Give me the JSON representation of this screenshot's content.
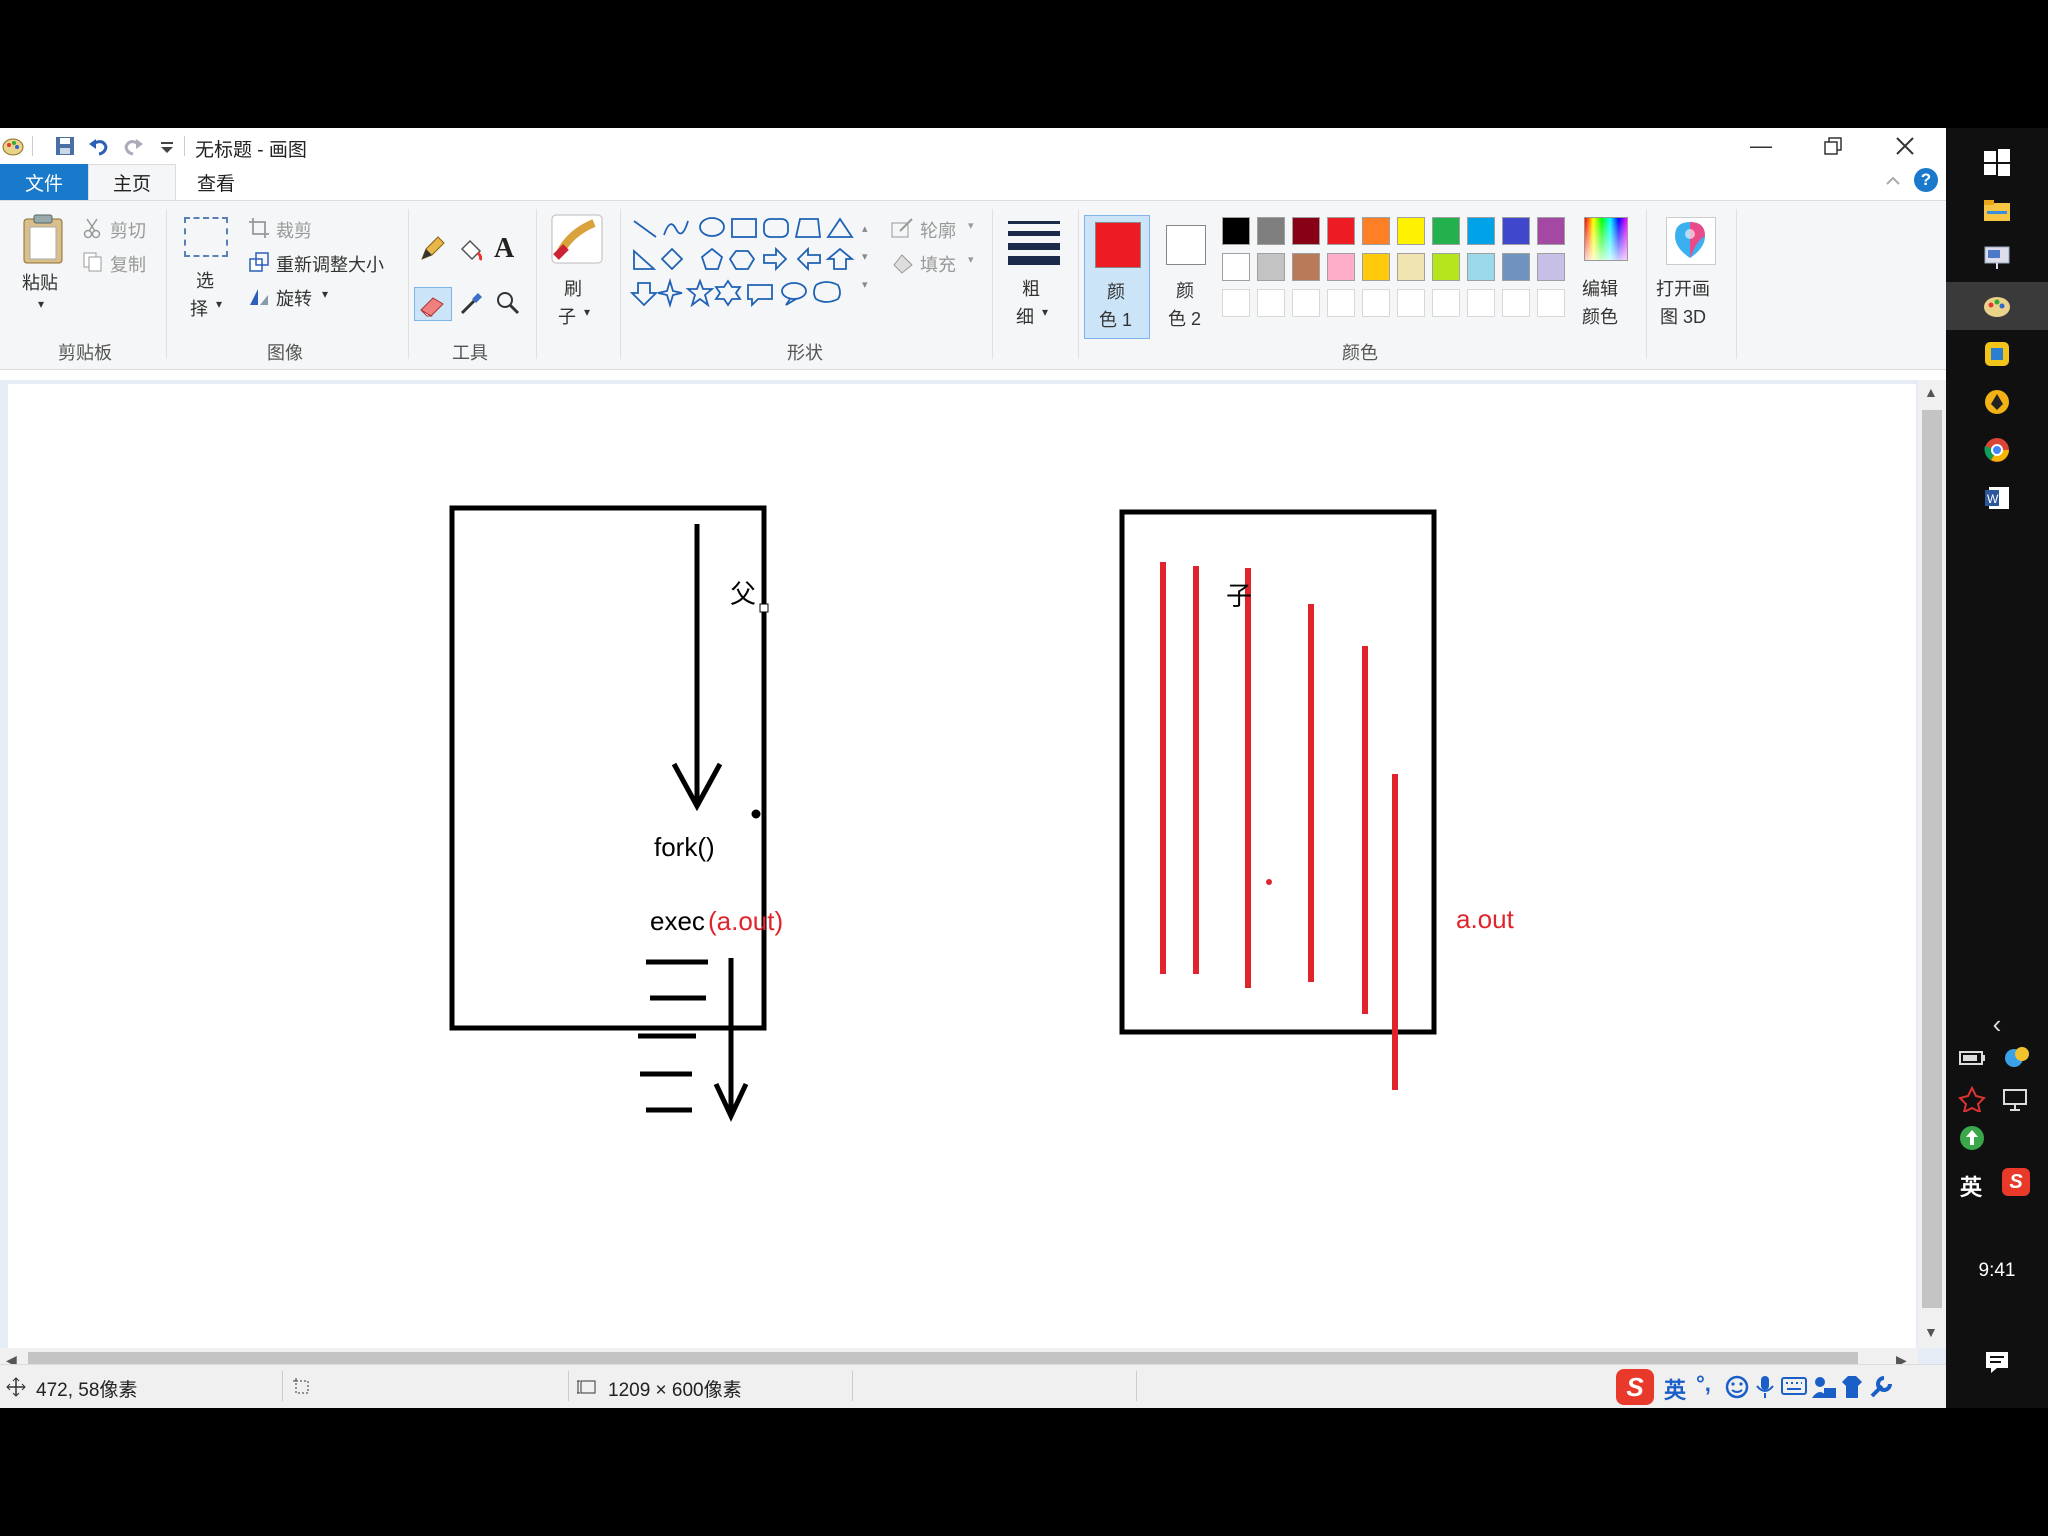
{
  "window": {
    "title": "无标题 - 画图",
    "tabs": {
      "file": "文件",
      "home": "主页",
      "view": "查看"
    }
  },
  "ribbon": {
    "clipboard": {
      "paste": "粘贴",
      "cut": "剪切",
      "copy": "复制",
      "label": "剪贴板"
    },
    "image": {
      "select_1": "选",
      "select_2": "择",
      "crop": "裁剪",
      "resize": "重新调整大小",
      "rotate": "旋转",
      "label": "图像"
    },
    "tools": {
      "label": "工具",
      "text_tool": "A"
    },
    "brushes": {
      "label_1": "刷",
      "label_2": "子"
    },
    "shapes": {
      "outline": "轮廓",
      "fill": "填充",
      "label": "形状"
    },
    "size": {
      "label_1": "粗",
      "label_2": "细"
    },
    "colors": {
      "color1_1": "颜",
      "color1_2": "色 1",
      "color2_1": "颜",
      "color2_2": "色 2",
      "edit_1": "编辑",
      "edit_2": "颜色",
      "label": "颜色",
      "color1_value": "#ed1c24",
      "color2_value": "#ffffff",
      "row1": [
        "#000000",
        "#7f7f7f",
        "#880015",
        "#ed1c24",
        "#ff7f27",
        "#fff200",
        "#22b14c",
        "#00a2e8",
        "#3f48cc",
        "#a349a4"
      ],
      "row2": [
        "#ffffff",
        "#c3c3c3",
        "#b97a57",
        "#ffaec9",
        "#ffc90e",
        "#efe4b0",
        "#b5e61d",
        "#99d9ea",
        "#7092be",
        "#c8bfe7"
      ],
      "row3": [
        "#ffffff",
        "#ffffff",
        "#ffffff",
        "#ffffff",
        "#ffffff",
        "#ffffff",
        "#ffffff",
        "#ffffff",
        "#ffffff",
        "#ffffff"
      ]
    },
    "paint3d": {
      "label_1": "打开画",
      "label_2": "图 3D"
    }
  },
  "drawing": {
    "parent_label": "父",
    "child_label": "子",
    "fork_text": "fork()",
    "exec_text": "exec",
    "exec_arg": "(a.out)",
    "child_side_label": "a.out",
    "ink_color": "#000000",
    "accent_color": "#e0242c"
  },
  "status": {
    "cursor_pos": "472, 58像素",
    "canvas_size": "1209 × 600像素"
  },
  "taskbar": {
    "lang": "英",
    "ime_lang": "英",
    "clock": "9:41"
  }
}
